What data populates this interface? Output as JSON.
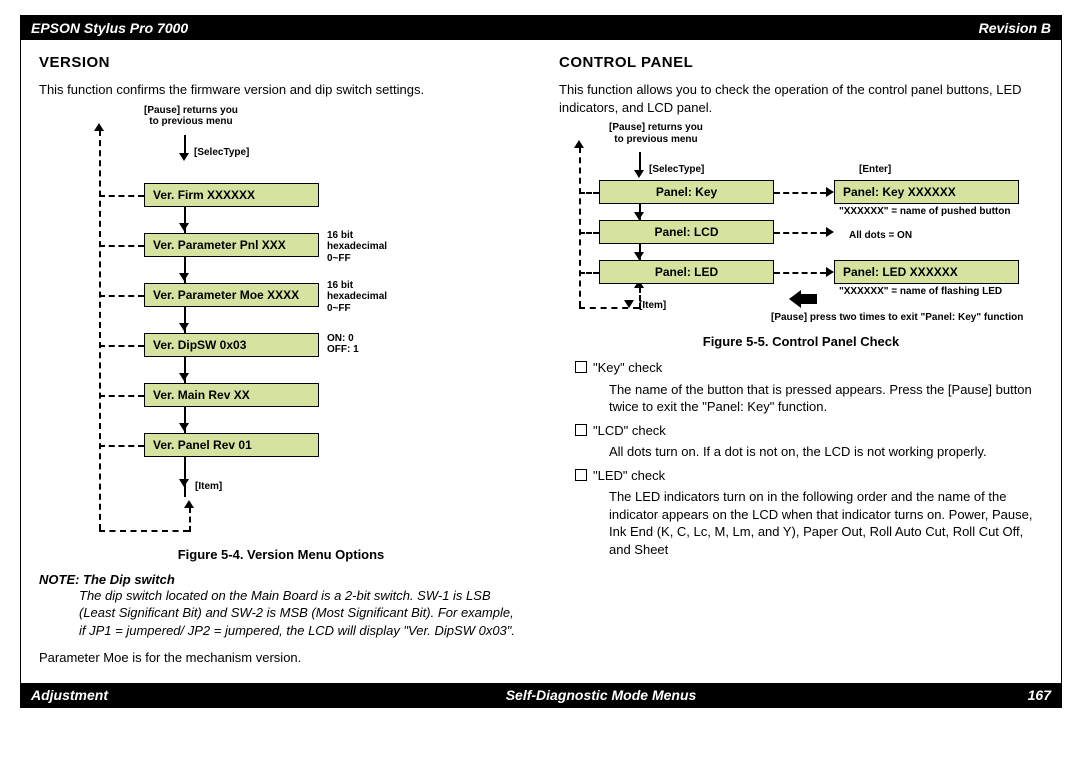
{
  "header": {
    "left": "EPSON Stylus Pro 7000",
    "right": "Revision B"
  },
  "footer": {
    "left": "Adjustment",
    "center": "Self-Diagnostic Mode Menus",
    "right": "167"
  },
  "version": {
    "title": "VERSION",
    "intro": "This function confirms the firmware version and dip switch settings.",
    "figcap": "Figure 5-4.  Version Menu Options",
    "note_head": "NOTE:  The Dip switch",
    "note_body": "The dip switch located on the Main Board is a 2-bit switch. SW-1 is LSB (Least Significant Bit) and SW-2 is MSB (Most Significant Bit). For example, if JP1 = jumpered/ JP2 = jumpered, the LCD will display \"Ver. DipSW 0x03\".",
    "tail": "Parameter Moe is for the mechanism version.",
    "pause_note": "[Pause] returns you\nto previous menu",
    "selectype": "[SelecType]",
    "item_label": "[Item]",
    "boxes": {
      "firm": "Ver. Firm      XXXXXX",
      "ppnl": "Ver. Parameter Pnl   XXX",
      "pmoe": "Ver. Parameter Moe XXXX",
      "dip": "Ver. DipSW    0x03",
      "main": "Ver. Main Rev     XX",
      "panel": "Ver. Panel Rev     01"
    },
    "side1": "16 bit\nhexadecimal\n0~FF",
    "side2": "16 bit\nhexadecimal\n0~FF",
    "side3": "ON: 0\nOFF: 1"
  },
  "control": {
    "title": "CONTROL PANEL",
    "intro": "This function allows you to check the operation of the control panel buttons, LED indicators, and LCD panel.",
    "figcap": "Figure 5-5.  Control Panel Check",
    "pause_note": "[Pause] returns you\nto previous menu",
    "selectype": "[SelecType]",
    "enter": "[Enter]",
    "item_label": "[Item]",
    "pause_exit": "[Pause] press two times to exit \"Panel: Key\" function",
    "boxes": {
      "key": "Panel: Key",
      "lcd": "Panel: LCD",
      "led": "Panel: LED",
      "key_r": "Panel: Key      XXXXXX",
      "led_r": "Panel: LED      XXXXXX"
    },
    "note_key": "\"XXXXXX\" = name of pushed button",
    "note_lcd": "All dots = ON",
    "note_led": "\"XXXXXX\" = name of flashing LED",
    "checks": {
      "key_t": "\"Key\" check",
      "key_d": "The name of the button that is pressed appears. Press the [Pause] button twice to exit the \"Panel: Key\" function.",
      "lcd_t": "\"LCD\" check",
      "lcd_d": "All dots turn on. If a dot is not on, the LCD is not working properly.",
      "led_t": "\"LED\" check",
      "led_d": "The LED indicators turn on in the following order and the name of the indicator appears on the LCD when that indicator turns on. Power, Pause, Ink End (K, C, Lc, M, Lm, and Y), Paper Out, Roll Auto Cut, Roll Cut Off, and Sheet"
    }
  }
}
